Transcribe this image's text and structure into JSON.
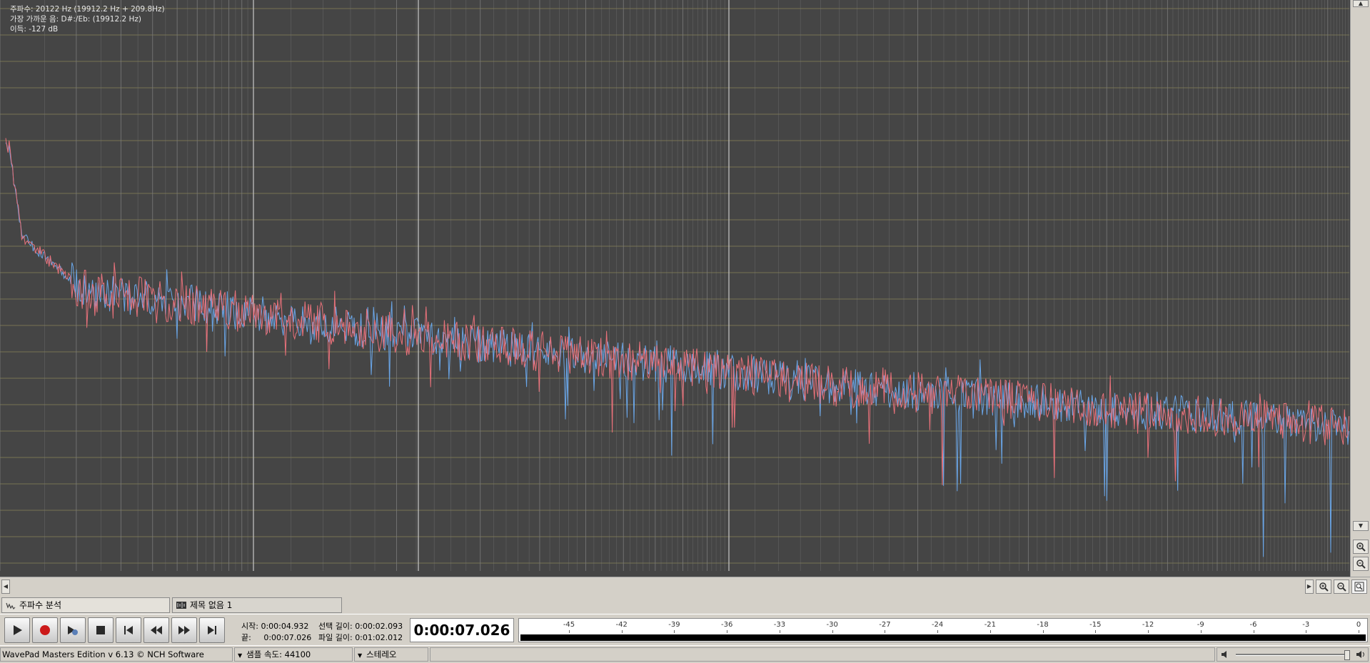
{
  "spectrum": {
    "info": {
      "frequency": "주파수: 20122 Hz (19912.2 Hz + 209.8Hz)",
      "nearest_note": "가장 가까운 음: D#:/Eb: (19912.2 Hz)",
      "gain": "이득: -127 dB"
    },
    "colors": {
      "background": "#454545",
      "grid_horizontal": "#9c9660",
      "grid_vertical": "#7a7a7a",
      "left_channel": "#e8717a",
      "right_channel": "#6aa6e8"
    },
    "axis_scale": "log-frequency"
  },
  "tabs": [
    {
      "label": "주파수 분석",
      "icon": "spectrum-icon"
    },
    {
      "label": "제목 없음 1",
      "icon": "waveform-icon"
    }
  ],
  "transport": {
    "buttons": [
      {
        "name": "play",
        "icon": "play-icon"
      },
      {
        "name": "record",
        "icon": "record-icon"
      },
      {
        "name": "scrub",
        "icon": "scrub-icon"
      },
      {
        "name": "stop",
        "icon": "stop-icon"
      },
      {
        "name": "go-start",
        "icon": "skip-start-icon"
      },
      {
        "name": "rewind",
        "icon": "rewind-icon"
      },
      {
        "name": "fast-forward",
        "icon": "fast-forward-icon"
      },
      {
        "name": "go-end",
        "icon": "skip-end-icon"
      }
    ],
    "start_label": "시작:",
    "start_value": "0:00:04.932",
    "end_label": "끝:",
    "end_value": "0:00:07.026",
    "selection_length_label": "선택 길이:",
    "selection_length_value": "0:00:02.093",
    "file_length_label": "파일 길이:",
    "file_length_value": "0:01:02.012",
    "current_time": "0:00:07.026"
  },
  "meter": {
    "labels": [
      "-45",
      "-42",
      "-39",
      "-36",
      "-33",
      "-30",
      "-27",
      "-24",
      "-21",
      "-18",
      "-15",
      "-12",
      "-9",
      "-6",
      "-3",
      "0"
    ]
  },
  "status": {
    "app": "WavePad Masters Edition v 6.13 © NCH Software",
    "sample_rate": "샘플 속도: 44100",
    "channels": "스테레오"
  }
}
